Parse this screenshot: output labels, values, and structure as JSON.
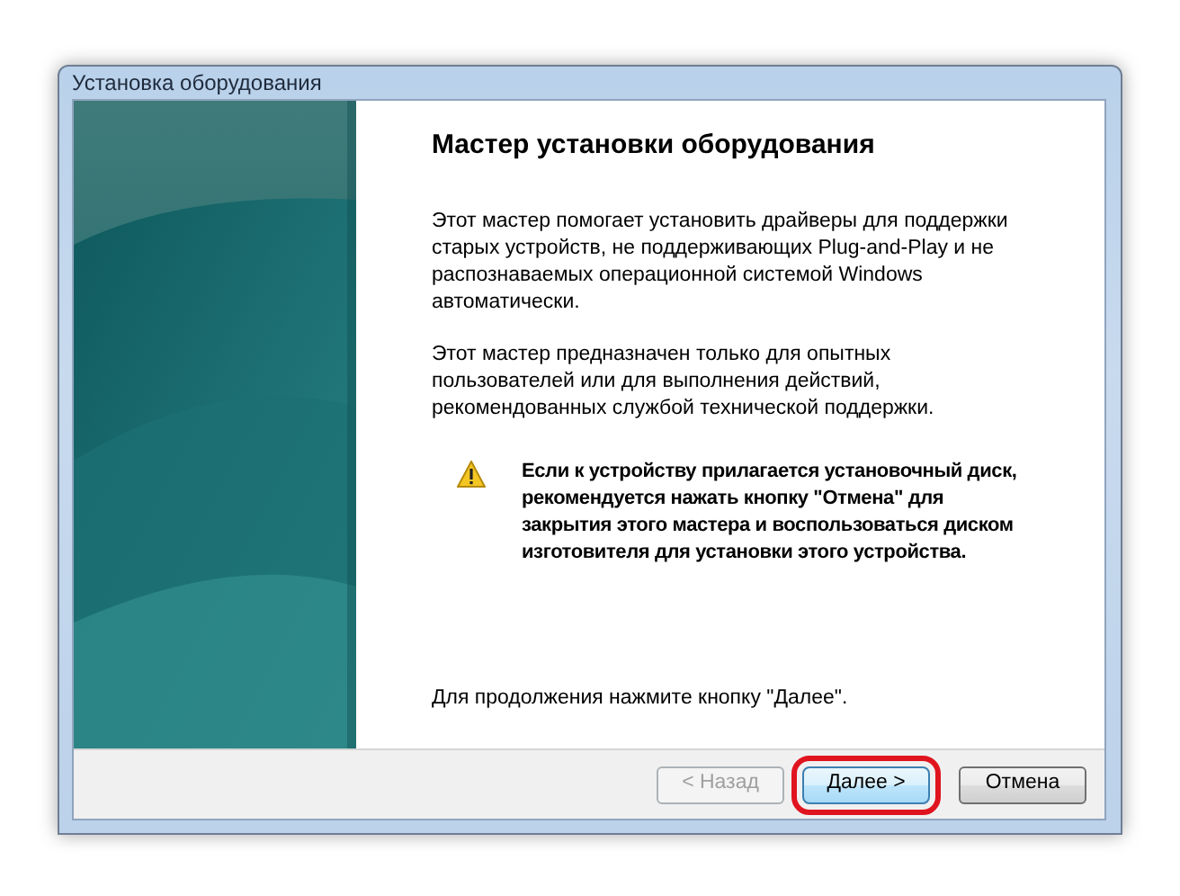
{
  "window": {
    "title": "Установка оборудования"
  },
  "heading": "Мастер установки оборудования",
  "paragraphs": [
    {
      "kind": "text",
      "lines": [
        "Этот мастер помогает установить драйверы для поддержки",
        "старых устройств, не поддерживающих Plug-and-Play и не",
        "распознаваемых операционной системой Windows",
        "автоматически."
      ]
    },
    {
      "kind": "text",
      "lines": [
        "Этот мастер предназначен только для опытных",
        "пользователей или для выполнения действий,",
        "рекомендованных службой технической поддержки."
      ]
    },
    {
      "kind": "warning",
      "lines": [
        "Если к устройству прилагается установочный диск,",
        "рекомендуется нажать кнопку \"Отмена\" для",
        "закрытия этого мастера и воспользоваться диском",
        "изготовителя для установки этого устройства."
      ]
    }
  ],
  "footer_text": "Для продолжения нажмите кнопку \"Далее\".",
  "buttons": [
    {
      "label": "< Назад",
      "disabled": true,
      "highlighted": false
    },
    {
      "label": "Далее >",
      "disabled": false,
      "highlighted": true
    },
    {
      "label": "Отмена",
      "disabled": false,
      "highlighted": false
    }
  ]
}
